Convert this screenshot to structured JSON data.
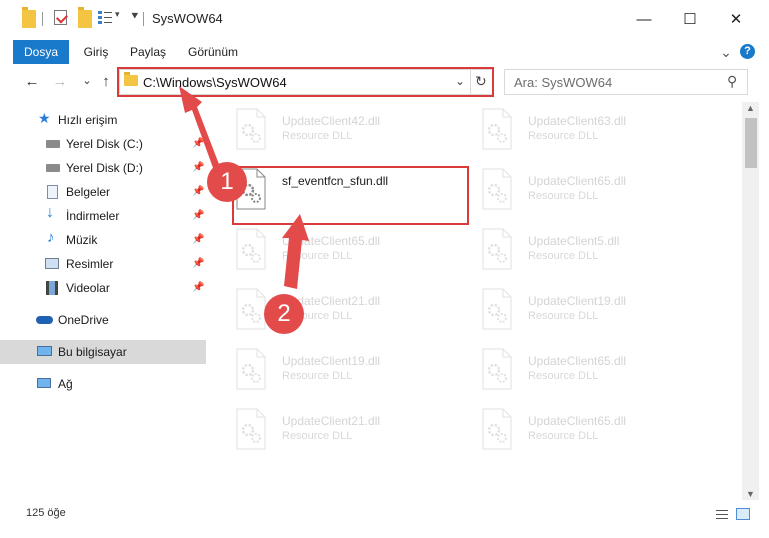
{
  "window": {
    "title": "SysWOW64",
    "minimize": "—",
    "maximize": "☐",
    "close": "✕"
  },
  "ribbon": {
    "tabs": [
      "Dosya",
      "Giriş",
      "Paylaş",
      "Görünüm"
    ],
    "expand": "⌄",
    "help": "?"
  },
  "nav": {
    "back": "←",
    "forward": "→",
    "recent": "⌄",
    "up": "↑",
    "address": "C:\\Windows\\SysWOW64",
    "address_dropdown": "⌄",
    "refresh": "↻",
    "search_placeholder": "Ara: SysWOW64",
    "search_icon": "⚲"
  },
  "sidebar": {
    "items": [
      {
        "label": "Hızlı erişim",
        "icon": "star-icon",
        "pinned": false
      },
      {
        "label": "Yerel Disk (C:)",
        "icon": "drive-icon",
        "pinned": true
      },
      {
        "label": "Yerel Disk (D:)",
        "icon": "drive-icon",
        "pinned": true
      },
      {
        "label": "Belgeler",
        "icon": "documents-icon",
        "pinned": true
      },
      {
        "label": "İndirmeler",
        "icon": "download-icon",
        "pinned": true
      },
      {
        "label": "Müzik",
        "icon": "music-icon",
        "pinned": true
      },
      {
        "label": "Resimler",
        "icon": "pictures-icon",
        "pinned": true
      },
      {
        "label": "Videolar",
        "icon": "video-icon",
        "pinned": true
      },
      {
        "label": "OneDrive",
        "icon": "cloud-icon",
        "pinned": false
      },
      {
        "label": "Bu bilgisayar",
        "icon": "computer-icon",
        "pinned": false
      },
      {
        "label": "Ağ",
        "icon": "network-icon",
        "pinned": false
      }
    ],
    "pin_glyph": "📌"
  },
  "files": [
    {
      "name": "UpdateClient42.dll",
      "desc": "Resource DLL"
    },
    {
      "name": "UpdateClient63.dll",
      "desc": "Resource DLL"
    },
    {
      "name": "sf_eventfcn_sfun.dll",
      "desc": ""
    },
    {
      "name": "UpdateClient65.dll",
      "desc": "Resource DLL"
    },
    {
      "name": "UpdateClient65.dll",
      "desc": "Resource DLL"
    },
    {
      "name": "UpdateClient5.dll",
      "desc": "Resource DLL"
    },
    {
      "name": "UpdateClient21.dll",
      "desc": "Resource DLL"
    },
    {
      "name": "UpdateClient19.dll",
      "desc": "Resource DLL"
    },
    {
      "name": "UpdateClient19.dll",
      "desc": "Resource DLL"
    },
    {
      "name": "UpdateClient65.dll",
      "desc": "Resource DLL"
    },
    {
      "name": "UpdateClient21.dll",
      "desc": "Resource DLL"
    },
    {
      "name": "UpdateClient65.dll",
      "desc": "Resource DLL"
    }
  ],
  "status": {
    "count": "125 öğe"
  },
  "annotations": {
    "step1": "1",
    "step2": "2",
    "color": "#e34b4b"
  }
}
